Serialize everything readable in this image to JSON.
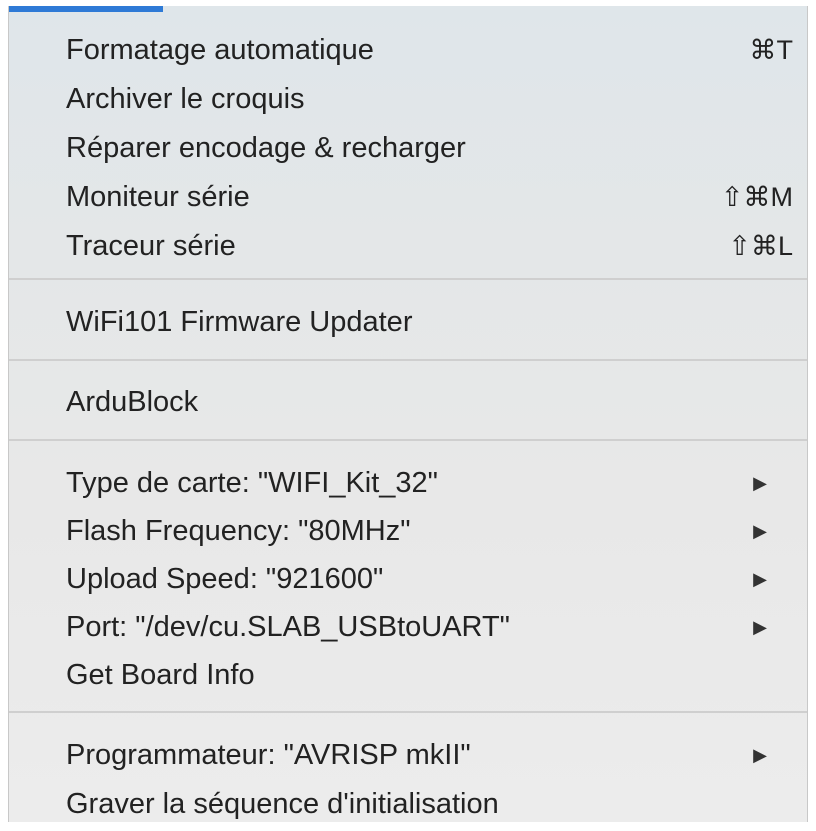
{
  "menu": {
    "group1": [
      {
        "label": "Formatage automatique",
        "shortcut": "⌘T"
      },
      {
        "label": "Archiver le croquis",
        "shortcut": ""
      },
      {
        "label": "Réparer encodage & recharger",
        "shortcut": ""
      },
      {
        "label": "Moniteur série",
        "shortcut": "⇧⌘M"
      },
      {
        "label": "Traceur série",
        "shortcut": "⇧⌘L"
      }
    ],
    "group2": [
      {
        "label": "WiFi101 Firmware Updater"
      }
    ],
    "group3": [
      {
        "label": "ArduBlock"
      }
    ],
    "group4": [
      {
        "label": "Type de carte: \"WIFI_Kit_32\"",
        "arrow": "▶"
      },
      {
        "label": "Flash Frequency: \"80MHz\"",
        "arrow": "▶"
      },
      {
        "label": "Upload Speed: \"921600\"",
        "arrow": "▶"
      },
      {
        "label": "Port: \"/dev/cu.SLAB_USBtoUART\"",
        "arrow": "▶"
      },
      {
        "label": "Get Board Info",
        "arrow": ""
      }
    ],
    "group5": [
      {
        "label": "Programmateur: \"AVRISP mkII\"",
        "arrow": "▶"
      },
      {
        "label": "Graver la séquence d'initialisation",
        "arrow": ""
      }
    ]
  },
  "colors": {
    "accent": "#2e7ad6",
    "menu_bg": "#e6e8e9",
    "separator": "#cfcfcf",
    "text": "#222222"
  }
}
